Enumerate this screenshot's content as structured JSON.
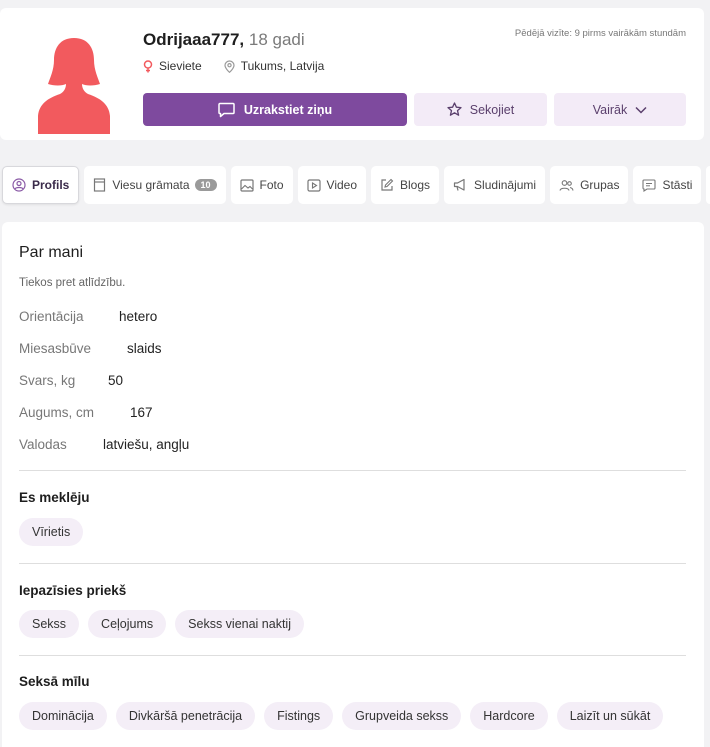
{
  "profile": {
    "username": "Odrijaaa777,",
    "age": "18 gadi",
    "last_visit": "Pēdējā vizīte: 9 pirms vairākām stundām",
    "gender": "Sieviete",
    "location": "Tukums, Latvija"
  },
  "actions": {
    "write": "Uzrakstiet ziņu",
    "follow": "Sekojiet",
    "more": "Vairāk"
  },
  "tabs": [
    {
      "label": "Profils",
      "icon": "user-circle-icon"
    },
    {
      "label": "Viesu grāmata",
      "icon": "book-icon",
      "badge": "10"
    },
    {
      "label": "Foto",
      "icon": "image-icon"
    },
    {
      "label": "Video",
      "icon": "video-icon"
    },
    {
      "label": "Blogs",
      "icon": "edit-icon"
    },
    {
      "label": "Sludinājumi",
      "icon": "megaphone-icon"
    },
    {
      "label": "Grupas",
      "icon": "users-icon"
    },
    {
      "label": "Stāsti",
      "icon": "chat-icon"
    }
  ],
  "about": {
    "title": "Par mani",
    "text": "Tiekos pret atlīdzību.",
    "attributes": [
      {
        "key": "Orientācija",
        "value": "hetero"
      },
      {
        "key": "Miesasbūve",
        "value": "slaids"
      },
      {
        "key": "Svars, kg",
        "value": "50"
      },
      {
        "key": "Augums, cm",
        "value": "167"
      },
      {
        "key": "Valodas",
        "value": "latviešu, angļu"
      }
    ]
  },
  "seeking": {
    "title": "Es meklēju",
    "items": [
      "Vīrietis"
    ]
  },
  "purpose": {
    "title": "Iepazīsies priekš",
    "items": [
      "Sekss",
      "Ceļojums",
      "Sekss vienai naktij"
    ]
  },
  "sex_likes": {
    "title": "Seksā mīlu",
    "items": [
      "Dominācija",
      "Divkāršā penetrācija",
      "Fistings",
      "Grupveida sekss",
      "Hardcore",
      "Laizīt un sūkāt"
    ]
  },
  "colors": {
    "accent": "#7e4a9e",
    "chip_bg": "#f4eef7",
    "avatar": "#f25a5e"
  }
}
